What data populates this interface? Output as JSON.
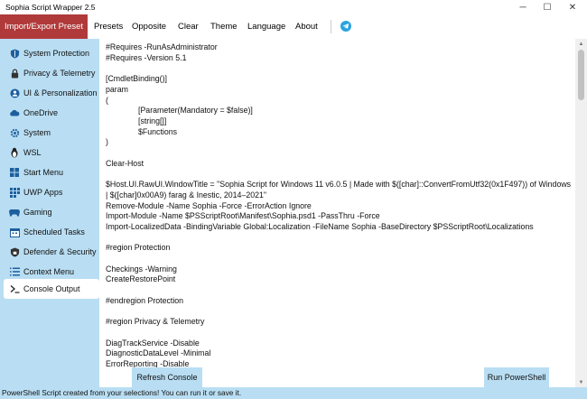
{
  "window": {
    "title": "Sophia Script Wrapper 2.5",
    "minimize_glyph": "─",
    "maximize_glyph": "☐",
    "close_glyph": "✕"
  },
  "menu": {
    "items": [
      "Import/Export Preset",
      "Presets",
      "Opposite",
      "Clear",
      "Theme",
      "Language",
      "About"
    ],
    "active": "Import/Export Preset",
    "telegram_icon": "telegram-icon"
  },
  "sidebar": {
    "items": [
      {
        "label": "System Protection",
        "icon": "shield-icon"
      },
      {
        "label": "Privacy & Telemetry",
        "icon": "lock-icon"
      },
      {
        "label": "UI & Personalization",
        "icon": "person-icon"
      },
      {
        "label": "OneDrive",
        "icon": "cloud-icon"
      },
      {
        "label": "System",
        "icon": "gear-icon"
      },
      {
        "label": "WSL",
        "icon": "penguin-icon"
      },
      {
        "label": "Start Menu",
        "icon": "windows-icon"
      },
      {
        "label": "UWP Apps",
        "icon": "apps-icon"
      },
      {
        "label": "Gaming",
        "icon": "gamepad-icon"
      },
      {
        "label": "Scheduled Tasks",
        "icon": "calendar-icon"
      },
      {
        "label": "Defender & Security",
        "icon": "shield-lock-icon"
      },
      {
        "label": "Context Menu",
        "icon": "list-icon"
      },
      {
        "label": "Console Output",
        "icon": "terminal-icon"
      }
    ],
    "active": "Console Output"
  },
  "console": {
    "lines": [
      "#Requires -RunAsAdministrator",
      "#Requires -Version 5.1",
      "",
      "[CmdletBinding()]",
      "param",
      "(",
      "[Parameter(Mandatory = $false)]",
      "[string[]]",
      "$Functions",
      ")",
      "",
      "Clear-Host",
      "",
      "$Host.UI.RawUI.WindowTitle = \"Sophia Script for Windows 11 v6.0.5 | Made with $([char]::ConvertFromUtf32(0x1F497)) of Windows | $([char]0x00A9) farag & Inestic, 2014–2021\"",
      "Remove-Module -Name Sophia -Force -ErrorAction Ignore",
      "Import-Module -Name $PSScriptRoot\\Manifest\\Sophia.psd1 -PassThru -Force",
      "Import-LocalizedData -BindingVariable Global:Localization -FileName Sophia -BaseDirectory $PSScriptRoot\\Localizations",
      "",
      "#region Protection",
      "",
      "Checkings -Warning",
      "CreateRestorePoint",
      "",
      "#endregion Protection",
      "",
      "#region Privacy & Telemetry",
      "",
      "DiagTrackService -Disable",
      "DiagnosticDataLevel -Minimal",
      "ErrorReporting -Disable"
    ],
    "indented": [
      6,
      7,
      8
    ]
  },
  "buttons": {
    "refresh": "Refresh Console",
    "run": "Run PowerShell"
  },
  "status": "PowerShell Script created from your selections! You can run it or save it.",
  "colors": {
    "accent": "#b03a3a",
    "sidebar": "#b9def3",
    "telegram": "#2aa3df"
  }
}
